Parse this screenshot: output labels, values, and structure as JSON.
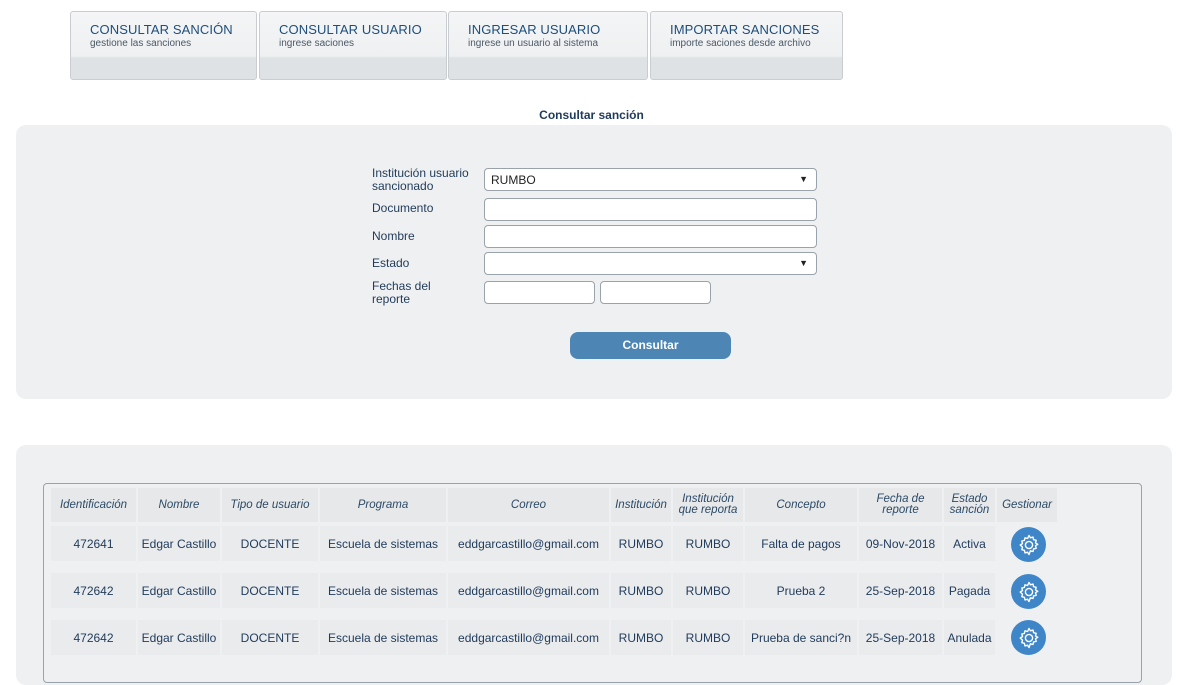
{
  "tabs": [
    {
      "title": "CONSULTAR SANCIÓN",
      "subtitle": "gestione las sanciones"
    },
    {
      "title": "CONSULTAR USUARIO",
      "subtitle": "ingrese saciones"
    },
    {
      "title": "INGRESAR USUARIO",
      "subtitle": "ingrese un usuario al sistema"
    },
    {
      "title": "IMPORTAR SANCIONES",
      "subtitle": "importe saciones desde archivo"
    }
  ],
  "section_title": "Consultar sanción",
  "form": {
    "institucion_label": "Institución usuario sancionado",
    "institucion_value": "RUMBO",
    "documento_label": "Documento",
    "documento_value": "",
    "nombre_label": "Nombre",
    "nombre_value": "",
    "estado_label": "Estado",
    "estado_value": "",
    "fechas_label": "Fechas del reporte",
    "fecha_desde_value": "",
    "fecha_hasta_value": "",
    "submit_label": "Consultar"
  },
  "table": {
    "headers": [
      "Identificación",
      "Nombre",
      "Tipo de usuario",
      "Programa",
      "Correo",
      "Institución",
      "Institución que reporta",
      "Concepto",
      "Fecha de reporte",
      "Estado sanción",
      "Gestionar"
    ],
    "rows": [
      [
        "472641",
        "Edgar Castillo",
        "DOCENTE",
        "Escuela de sistemas",
        "eddgarcastillo@gmail.com",
        "RUMBO",
        "RUMBO",
        "Falta de pagos",
        "09-Nov-2018",
        "Activa"
      ],
      [
        "472642",
        "Edgar Castillo",
        "DOCENTE",
        "Escuela de sistemas",
        "eddgarcastillo@gmail.com",
        "RUMBO",
        "RUMBO",
        "Prueba 2",
        "25-Sep-2018",
        "Pagada"
      ],
      [
        "472642",
        "Edgar Castillo",
        "DOCENTE",
        "Escuela de sistemas",
        "eddgarcastillo@gmail.com",
        "RUMBO",
        "RUMBO",
        "Prueba de sanci?n",
        "25-Sep-2018",
        "Anulada"
      ]
    ]
  },
  "icons": {
    "row_action": "gear-icon",
    "select_arrow": "triangle-down-icon"
  },
  "colors": {
    "accent": "#4d85b5",
    "gear": "#3f86c9",
    "panel": "#eff0f1"
  }
}
